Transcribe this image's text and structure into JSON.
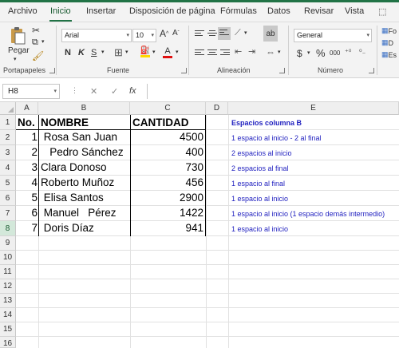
{
  "tabs": [
    "Archivo",
    "Inicio",
    "Insertar",
    "Disposición de página",
    "Fórmulas",
    "Datos",
    "Revisar",
    "Vista"
  ],
  "ribbon": {
    "paste_label": "Pegar",
    "groups": [
      "Portapapeles",
      "Fuente",
      "Alineación",
      "Número"
    ],
    "font_name": "Arial",
    "font_size": "10",
    "bold": "N",
    "italic": "K",
    "underline": "S",
    "number_format": "General",
    "currency": "$",
    "percent": "%",
    "thousands": "000",
    "cond_items": [
      "Fo",
      "D",
      "Es"
    ]
  },
  "formula_bar": {
    "name_box": "H8",
    "cancel": "✕",
    "enter": "✓",
    "fx": "fx",
    "value": ""
  },
  "sheet": {
    "columns": [
      "A",
      "B",
      "C",
      "D",
      "E"
    ],
    "rows": [
      "1",
      "2",
      "3",
      "4",
      "5",
      "6",
      "7",
      "8",
      "9",
      "10",
      "11",
      "12",
      "13",
      "14",
      "15",
      "16"
    ],
    "selected_row": "8",
    "header": {
      "a": "No.",
      "b": "NOMBRE",
      "c": "CANTIDAD",
      "e": "Espacios columna B"
    },
    "data": [
      {
        "a": "1",
        "b": " Rosa San Juan",
        "c": "4500",
        "e": "1 espacio al inicio - 2 al final"
      },
      {
        "a": "2",
        "b": "   Pedro Sánchez",
        "c": "400",
        "e": "2 espacios al inicio"
      },
      {
        "a": "3",
        "b": "Clara Donoso",
        "c": "730",
        "e": "2 espacios al final"
      },
      {
        "a": "4",
        "b": "Roberto Muñoz",
        "c": "456",
        "e": "1 espacio al final"
      },
      {
        "a": "5",
        "b": " Elisa Santos",
        "c": "2900",
        "e": "1 espacio al inicio"
      },
      {
        "a": "6",
        "b": " Manuel   Pérez",
        "c": "1422",
        "e": "1 espacio al inicio (1 espacio demás intermedio)"
      },
      {
        "a": "7",
        "b": " Doris Díaz",
        "c": "941",
        "e": "1 espacio al inicio"
      }
    ]
  },
  "colors": {
    "accent": "#217346",
    "note_text": "#1f1fbf"
  }
}
